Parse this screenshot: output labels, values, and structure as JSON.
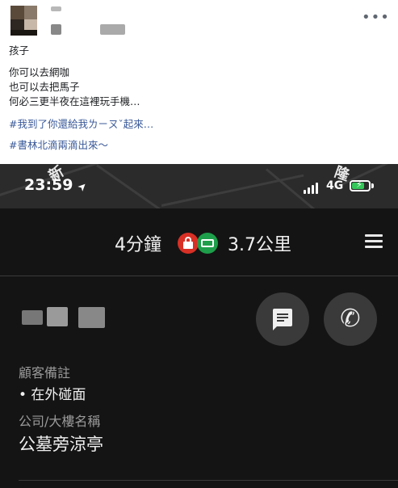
{
  "post": {
    "more_label": "•••",
    "lines": [
      "孩子",
      "你可以去網咖",
      "也可以去把馬子",
      "何必三更半夜在這裡玩手機…"
    ],
    "hashtags": [
      "#我到了你還給我ㄌㄧㄡˇ起來…",
      "#書林北滴兩滴出來～"
    ]
  },
  "phone": {
    "status": {
      "time": "23:59",
      "location_arrow": "➤",
      "network": "4G",
      "map_labels": [
        "新",
        "隆"
      ]
    },
    "trip": {
      "duration": "4分鐘",
      "distance": "3.7公里",
      "icons": [
        "lock-icon",
        "cash-icon",
        "menu-icon"
      ]
    },
    "customer": {
      "call_icon": "✆",
      "note_label": "顧客備註",
      "note_value": "• 在外碰面",
      "company_label": "公司/大樓名稱",
      "company_value": "公墓旁涼亭"
    }
  },
  "colors": {
    "hashtag": "#385898",
    "dark_bg": "#141414",
    "green": "#1e9e4a",
    "red": "#d93025"
  }
}
